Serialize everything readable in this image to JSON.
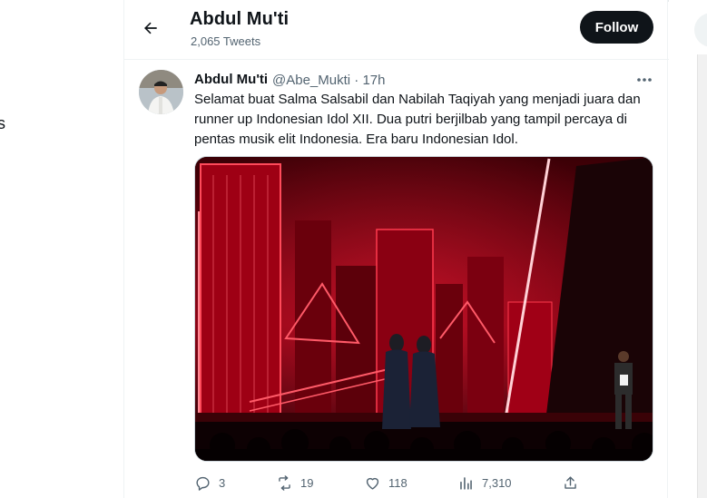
{
  "sidebar": {
    "partial_glyph": "s"
  },
  "header": {
    "title": "Abdul Mu'ti",
    "tweet_count": "2,065 Tweets",
    "follow_label": "Follow",
    "back_icon": "arrow-left-icon"
  },
  "tweet": {
    "author_name": "Abdul Mu'ti",
    "handle": "@Abe_Mukti",
    "separator": "·",
    "time": "17h",
    "more_icon": "more-dots-icon",
    "text": "Selamat buat Salma Salsabil dan Nabilah Taqiyah yang menjadi juara dan runner up Indonesian Idol XII. Dua putri berjilbab yang tampil percaya di pentas musik elit Indonesia. Era baru Indonesian Idol.",
    "media_icon": "photo-stage-red-city",
    "actions": {
      "reply": {
        "icon": "reply-icon",
        "count": "3"
      },
      "retweet": {
        "icon": "retweet-icon",
        "count": "19"
      },
      "like": {
        "icon": "heart-icon",
        "count": "118"
      },
      "views": {
        "icon": "views-icon",
        "count": "7,310"
      },
      "share": {
        "icon": "share-icon"
      }
    }
  },
  "colors": {
    "text_primary": "#0f1419",
    "text_secondary": "#536471",
    "follow_bg": "#0f1419",
    "stage_red": "#d8001a"
  }
}
